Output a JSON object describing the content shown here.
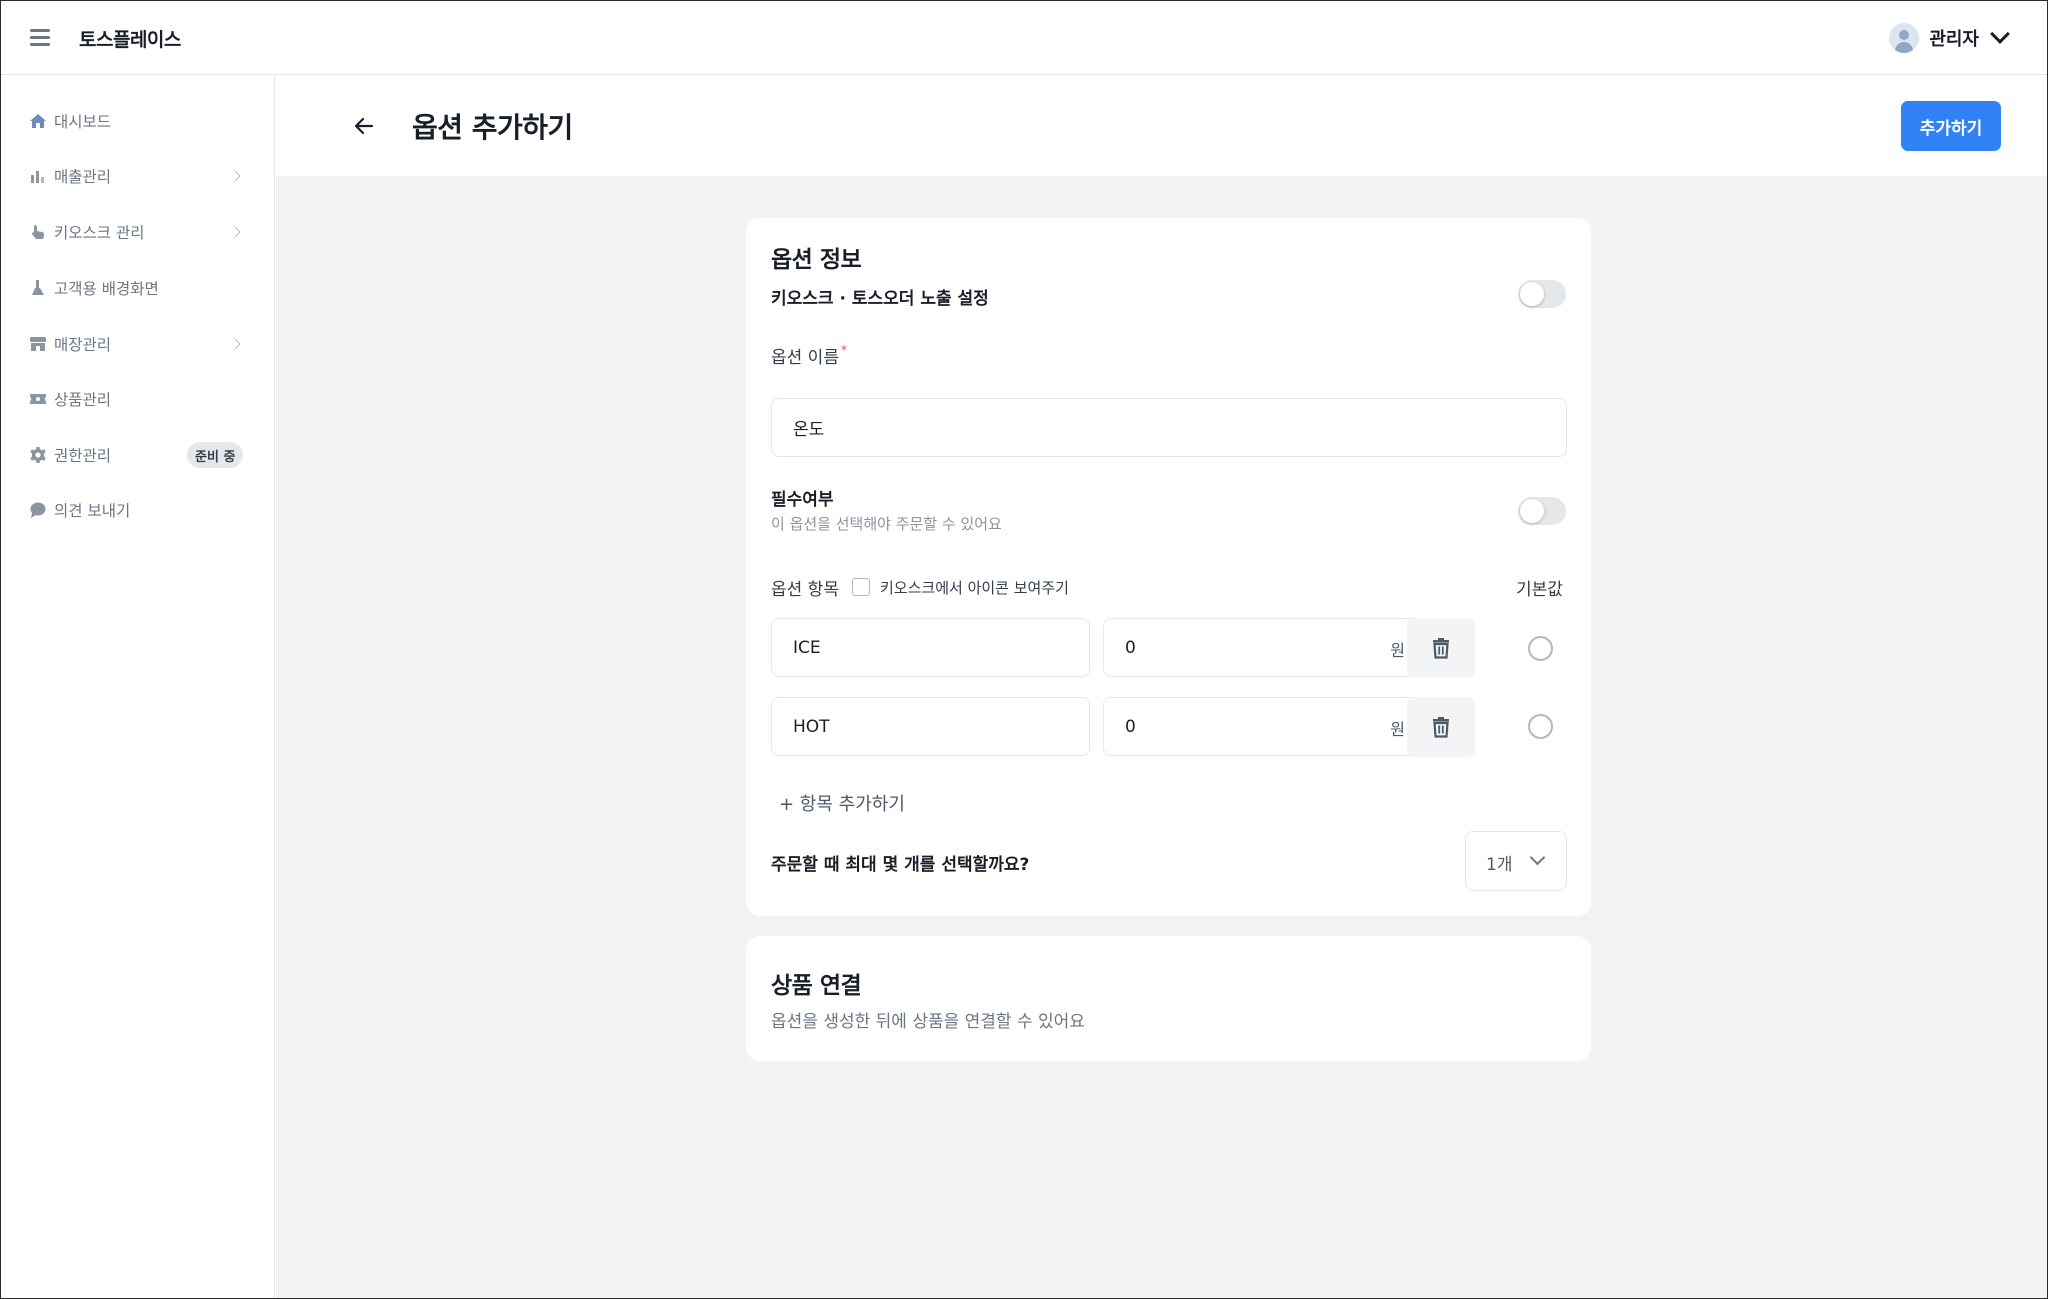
{
  "app": {
    "brand": "토스플레이스"
  },
  "user": {
    "name": "관리자"
  },
  "sidebar": {
    "items": [
      {
        "label": "대시보드",
        "icon": "home-icon",
        "has_chevron": false
      },
      {
        "label": "매출관리",
        "icon": "bar-chart-icon",
        "has_chevron": true
      },
      {
        "label": "키오스크 관리",
        "icon": "hand-pointer-icon",
        "has_chevron": true
      },
      {
        "label": "고객용 배경화면",
        "icon": "brush-icon",
        "has_chevron": false
      },
      {
        "label": "매장관리",
        "icon": "store-icon",
        "has_chevron": true
      },
      {
        "label": "상품관리",
        "icon": "ticket-icon",
        "has_chevron": false
      },
      {
        "label": "권한관리",
        "icon": "gear-icon",
        "has_chevron": false,
        "badge": "준비 중"
      },
      {
        "label": "의견 보내기",
        "icon": "chat-bubble-icon",
        "has_chevron": false
      }
    ]
  },
  "header": {
    "title": "옵션 추가하기",
    "primary_button": "추가하기"
  },
  "option_info": {
    "section_title": "옵션 정보",
    "exposure_label": "키오스크 · 토스오더 노출 설정",
    "exposure_toggle": false,
    "name_label": "옵션 이름",
    "name_required_mark": "*",
    "name_value": "온도",
    "required_label": "필수여부",
    "required_help": "이 옵션을 선택해야 주문할 수 있어요",
    "required_toggle": false,
    "items_label": "옵션 항목",
    "show_icon_label": "키오스크에서 아이콘 보여주기",
    "default_label": "기본값",
    "items": [
      {
        "name": "ICE",
        "price": "0",
        "unit": "원"
      },
      {
        "name": "HOT",
        "price": "0",
        "unit": "원"
      }
    ],
    "add_item_label": "+ 항목 추가하기",
    "max_select_label": "주문할 때 최대 몇 개를 선택할까요?",
    "max_select_value": "1개"
  },
  "product_link": {
    "section_title": "상품 연결",
    "description": "옵션을 생성한 뒤에 상품을 연결할 수 있어요"
  },
  "colors": {
    "primary": "#3182f6",
    "background": "#f2f3f5",
    "required_mark": "#f04452"
  }
}
